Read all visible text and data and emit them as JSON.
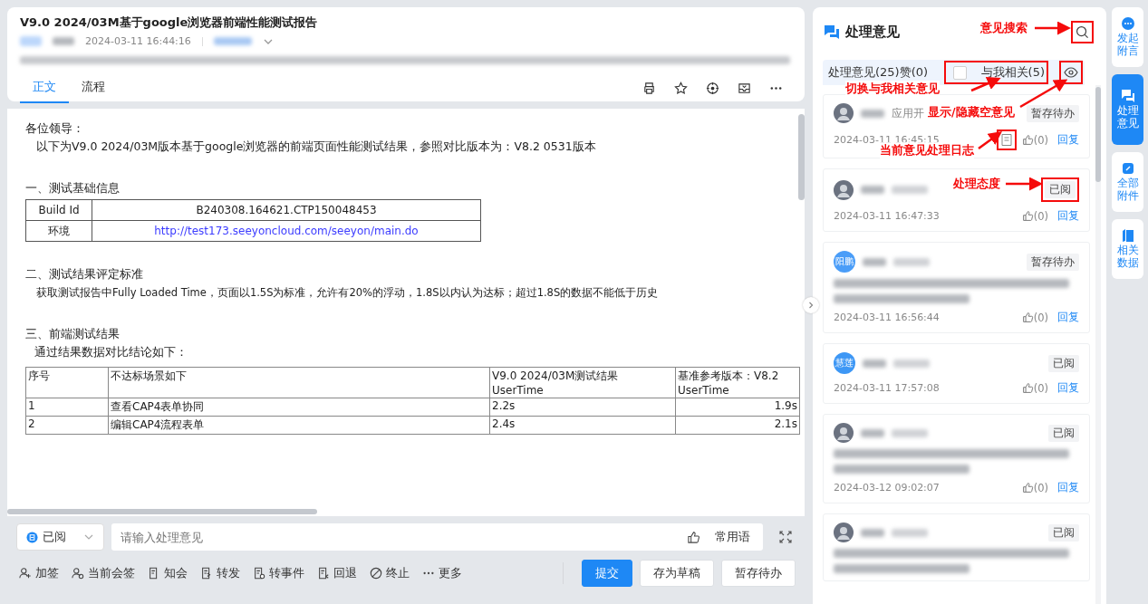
{
  "document": {
    "title": "V9.0 2024/03M基于google浏览器前端性能测试报告",
    "sent_time": "2024-03-11 16:44:16",
    "tabs": [
      {
        "label": "正文",
        "selected": true
      },
      {
        "label": "流程",
        "selected": false
      }
    ]
  },
  "body": {
    "greeting": "各位领导：",
    "intro": "以下为V9.0  2024/03M版本基于google浏览器的前端页面性能测试结果，参照对比版本为：V8.2 0531版本",
    "section_1": "一、测试基础信息",
    "info_rows": [
      {
        "label": "Build Id",
        "value": "B240308.164621.CTP150048453",
        "kind": "text"
      },
      {
        "label": "环境",
        "value": "http://test173.seeyoncloud.com/seeyon/main.do",
        "kind": "link"
      }
    ],
    "section_2": "二、测试结果评定标准",
    "criteria": "获取测试报告中Fully Loaded Time，页面以1.5S为标准，允许有20%的浮动，1.8S以内认为达标；超过1.8S的数据不能低于历史",
    "section_3": "三、前端测试结果",
    "conclusion": "通过结果数据对比结论如下：",
    "result_table": {
      "columns": [
        "序号",
        "不达标场景如下",
        "V9.0  2024/03M测试结果",
        "基准参考版本：V8.2"
      ],
      "subheader": [
        "UserTime",
        "UserTime"
      ],
      "rows": [
        [
          "1",
          "查看CAP4表单协同",
          "2.2s",
          "1.9s"
        ],
        [
          "2",
          "编辑CAP4流程表单",
          "2.4s",
          "2.1s"
        ]
      ]
    }
  },
  "composer": {
    "attitude": "已阅",
    "placeholder": "请输入处理意见",
    "phrases": "常用语",
    "actions": [
      {
        "label": "加签",
        "kind": "add-user"
      },
      {
        "label": "当前会签",
        "kind": "users"
      },
      {
        "label": "知会",
        "kind": "doc"
      },
      {
        "label": "转发",
        "kind": "forward"
      },
      {
        "label": "转事件",
        "kind": "event"
      },
      {
        "label": "回退",
        "kind": "back"
      },
      {
        "label": "终止",
        "kind": "stop"
      },
      {
        "label": "更多",
        "kind": "more"
      }
    ],
    "buttons": [
      {
        "label": "提交",
        "primary": true
      },
      {
        "label": "存为草稿",
        "primary": false
      },
      {
        "label": "暂存待办",
        "primary": false
      }
    ]
  },
  "opinions": {
    "title": "处理意见",
    "summary": "处理意见(25)赞(0)",
    "related": {
      "label": "与我相关(5)",
      "checked": false
    },
    "items": [
      {
        "avatar": {
          "kind": "photo"
        },
        "dept": "应用开",
        "status": "暂存待办",
        "has_comment": false,
        "time": "2024-03-11 16:45:15",
        "has_log": true,
        "likes": "(0)",
        "reply": "回复"
      },
      {
        "avatar": {
          "kind": "photo"
        },
        "status": "已阅",
        "has_comment": false,
        "time": "2024-03-11 16:47:33",
        "has_log": false,
        "likes": "(0)",
        "reply": "回复"
      },
      {
        "avatar": {
          "kind": "initials",
          "text": "阳鹏",
          "color": "#4a9df8"
        },
        "status": "暂存待办",
        "has_comment": true,
        "time": "2024-03-11 16:56:44",
        "has_log": false,
        "likes": "(0)",
        "reply": "回复"
      },
      {
        "avatar": {
          "kind": "initials",
          "text": "慧莲",
          "color": "#3d97f5"
        },
        "status": "已阅",
        "has_comment": false,
        "time": "2024-03-11 17:57:08",
        "has_log": false,
        "likes": "(0)",
        "reply": "回复"
      },
      {
        "avatar": {
          "kind": "photo"
        },
        "status": "已阅",
        "has_comment": true,
        "time": "2024-03-12 09:02:07",
        "has_log": false,
        "likes": "(0)",
        "reply": "回复"
      },
      {
        "avatar": {
          "kind": "photo"
        },
        "status": "已阅",
        "has_comment": true,
        "has_log": false
      }
    ]
  },
  "sidebar": [
    {
      "label": "发起附言",
      "selected": false
    },
    {
      "label": "处理意见",
      "selected": true
    },
    {
      "label": "全部附件",
      "selected": false
    },
    {
      "label": "相关数据",
      "selected": false
    }
  ],
  "annotations": [
    "意见搜索",
    "切换与我相关意见",
    "显示/隐藏空意见",
    "当前意见处理日志",
    "处理态度"
  ]
}
